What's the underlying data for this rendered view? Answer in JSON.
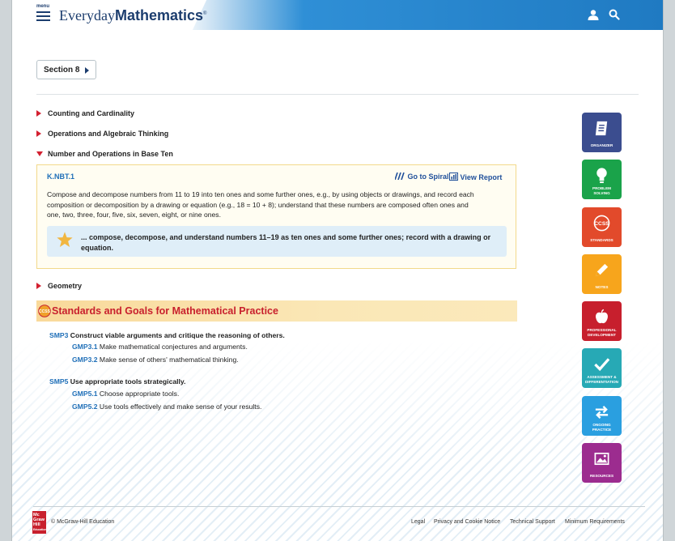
{
  "header": {
    "menu_label": "menu",
    "brand_part1": "Everyday",
    "brand_part2": "Mathematics",
    "brand_mark": "®",
    "colors": {
      "bar_start": "#2f8fd6",
      "bar_end": "#1f7ac2",
      "brand": "#1c3d6e"
    },
    "icons": [
      "menu-icon",
      "user-icon",
      "search-icon"
    ]
  },
  "section": {
    "label": "Section 8"
  },
  "domains": [
    {
      "label": "Counting and Cardinality",
      "expanded": false
    },
    {
      "label": "Operations and Algebraic Thinking",
      "expanded": false
    },
    {
      "label": "Number and Operations in Base Ten",
      "expanded": true
    },
    {
      "label": "Geometry",
      "expanded": false
    }
  ],
  "standard": {
    "code": "K.NBT.1",
    "goto_spiral": "Go to Spiral",
    "view_report": "View Report",
    "description_1": "Compose and decompose numbers from 11 to 19 into ten ones and some further ones, e.g., by using objects or drawings, and record each",
    "description_2": "composition or decomposition by a drawing or equation (e.g., 18 = 10 + 8); understand that these numbers are composed often ones and",
    "description_3": "one, two, three, four, five, six, seven, eight, or nine ones.",
    "goal_line_1": "... compose, decompose, and understand numbers 11–19 as ten ones and some further ones; record with a drawing or",
    "goal_line_2": "equation."
  },
  "practice": {
    "badge": "CCSS",
    "title": "Standards and Goals for Mathematical Practice",
    "items": [
      {
        "code": "SMP3",
        "text": "Construct viable arguments and critique the reasoning of others.",
        "goals": [
          {
            "code": "GMP3.1",
            "text": "Make mathematical conjectures and arguments."
          },
          {
            "code": "GMP3.2",
            "text": "Make sense of others' mathematical thinking."
          }
        ]
      },
      {
        "code": "SMP5",
        "text": "Use appropriate tools strategically.",
        "goals": [
          {
            "code": "GMP5.1",
            "text": "Choose appropriate tools."
          },
          {
            "code": "GMP5.2",
            "text": "Use tools effectively and make sense of your results."
          }
        ]
      }
    ]
  },
  "tools": [
    {
      "label_1": "ORGANIZER",
      "label_2": "",
      "color": "#3b4d8f",
      "icon": "notebook-icon"
    },
    {
      "label_1": "PROBLEM",
      "label_2": "SOLVING",
      "color": "#1aa34a",
      "icon": "lightbulb-icon"
    },
    {
      "label_1": "STANDARDS",
      "label_2": "",
      "color": "#e24a2b",
      "icon": "ccss-icon"
    },
    {
      "label_1": "NOTES",
      "label_2": "",
      "color": "#f7a51c",
      "icon": "pencil-icon"
    },
    {
      "label_1": "PROFESSIONAL",
      "label_2": "DEVELOPMENT",
      "color": "#c71f2d",
      "icon": "apple-icon"
    },
    {
      "label_1": "ASSESSMENT &",
      "label_2": "DIFFERENTIATION",
      "color": "#27a9b5",
      "icon": "checkmark-icon"
    },
    {
      "label_1": "ONGOING",
      "label_2": "PRACTICE",
      "color": "#2a9fe0",
      "icon": "cycle-arrows-icon"
    },
    {
      "label_1": "RESOURCES",
      "label_2": "",
      "color": "#9c2c8f",
      "icon": "image-icon"
    }
  ],
  "footer": {
    "logo_1": "Mc",
    "logo_2": "Graw",
    "logo_3": "Hill",
    "logo_4": "Education",
    "copyright": "© McGraw-Hill Education",
    "links": [
      "Legal",
      "Privacy and Cookie Notice",
      "Technical Support",
      "Minimum Requirements"
    ]
  }
}
